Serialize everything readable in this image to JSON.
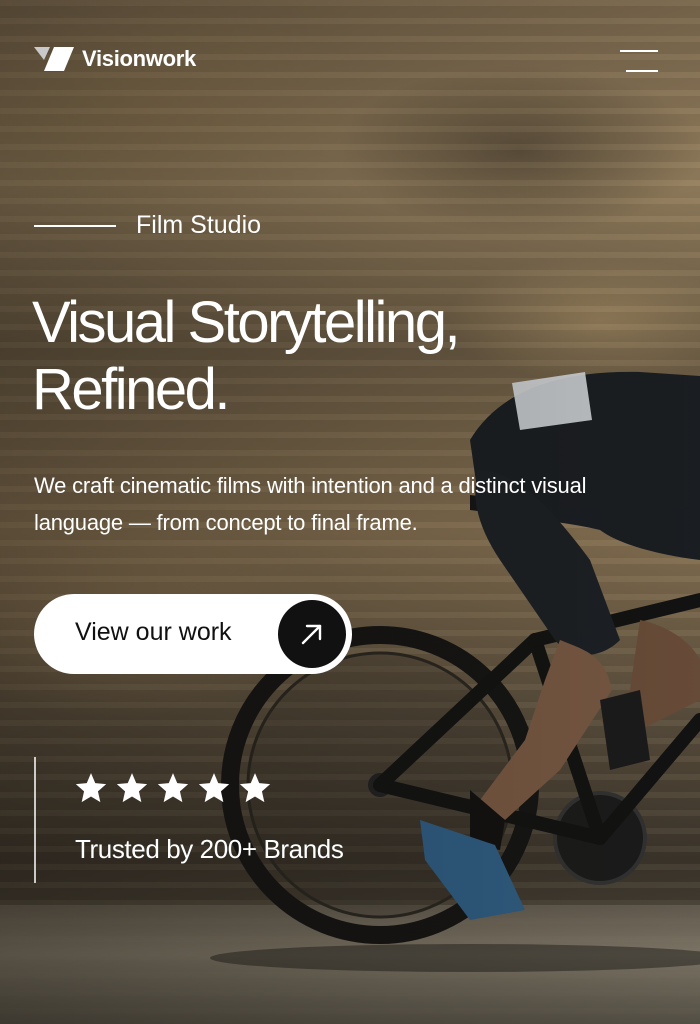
{
  "brand": {
    "name": "Visionwork",
    "logo_icon": "visionwork-logo-mark"
  },
  "nav": {
    "menu_icon": "hamburger-menu-icon"
  },
  "hero": {
    "eyebrow": "Film Studio",
    "headline_line1": "Visual Storytelling,",
    "headline_line2": "Refined.",
    "description": "We craft cinematic films with intention and a distinct visual language — from concept to final frame.",
    "cta_label": "View our work",
    "cta_icon": "arrow-up-right-icon"
  },
  "trust": {
    "rating": 5,
    "rating_max": 5,
    "star_icon": "star-icon",
    "text": "Trusted by 200+ Brands"
  },
  "colors": {
    "text": "#ffffff",
    "button_bg": "#ffffff",
    "button_text": "#111111",
    "button_icon_bg": "#111111"
  }
}
